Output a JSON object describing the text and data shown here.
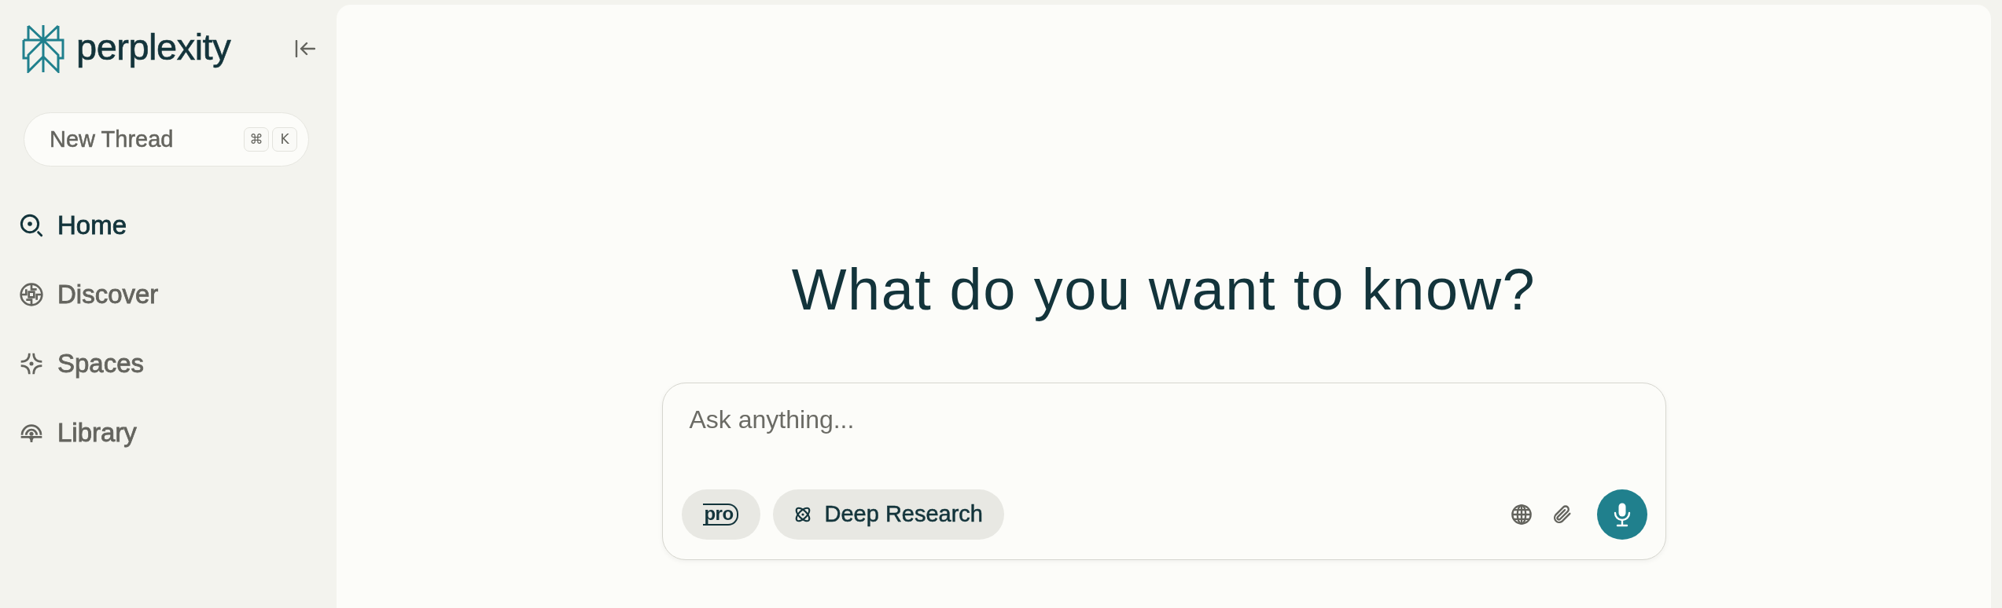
{
  "sidebar": {
    "logo": {
      "wordmark": "perplexity"
    },
    "new_thread": {
      "label": "New Thread",
      "shortcut": [
        "⌘",
        "K"
      ]
    },
    "nav": [
      {
        "label": "Home",
        "selected": true
      },
      {
        "label": "Discover",
        "selected": false
      },
      {
        "label": "Spaces",
        "selected": false
      },
      {
        "label": "Library",
        "selected": false
      }
    ]
  },
  "main": {
    "heading": "What do you want to know?",
    "composer": {
      "placeholder": "Ask anything...",
      "pro_toggle": {
        "label": "pro"
      },
      "mode_button": {
        "label": "Deep Research"
      }
    }
  }
}
